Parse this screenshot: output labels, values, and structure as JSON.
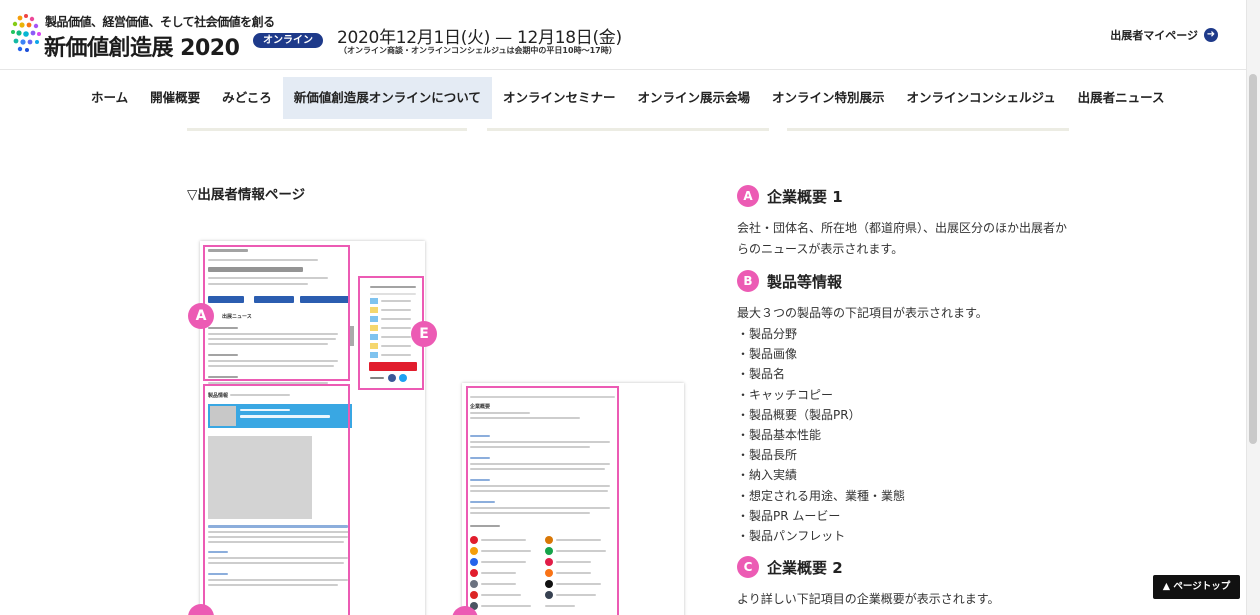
{
  "header": {
    "tagline": "製品価値、経営価値、そして社会価値を創る",
    "expo_name": "新価値創造展 2020",
    "online_badge": "オンライン",
    "date_range": "2020年12月1日(火) — 12月18日(金)",
    "date_note": "（オンライン商談・オンラインコンシェルジュは会期中の平日10時～17時）",
    "mypage_label": "出展者マイページ",
    "mypage_icon": "arrow-right-circle-icon"
  },
  "nav": {
    "items": [
      "ホーム",
      "開催概要",
      "みどころ",
      "新価値創造展オンラインについて",
      "オンラインセミナー",
      "オンライン展示会場",
      "オンライン特別展示",
      "オンラインコンシェルジュ",
      "出展者ニュース"
    ],
    "active_index": 3
  },
  "preview": {
    "heading": "▽出展者情報ページ",
    "markers": [
      "A",
      "E"
    ],
    "mock_text": {
      "news_label": "出展ニュース",
      "product_label": "製品情報",
      "company_label": "企業概要"
    }
  },
  "description": {
    "sections": [
      {
        "badge": "A",
        "title": "企業概要 1",
        "text": "会社・団体名、所在地（都道府県）、出展区分のほか出展者からのニュースが表示されます。"
      },
      {
        "badge": "B",
        "title": "製品等情報",
        "text": "最大３つの製品等の下記項目が表示されます。"
      },
      {
        "badge": "C",
        "title": "企業概要 2",
        "text": "より詳しい下記項目の企業概要が表示されます。"
      }
    ],
    "product_items": [
      "・製品分野",
      "・製品画像",
      "・製品名",
      "・キャッチコピー",
      "・製品概要（製品PR）",
      "・製品基本性能",
      "・製品長所",
      "・納入実績",
      "・想定される用途、業種・業態",
      "・製品PR ムービー",
      "・製品パンフレット"
    ]
  },
  "page_top_label": "▲ ページトップ",
  "colors": {
    "accent_pink": "#ec5bb4",
    "navy": "#1e3a8a",
    "nav_active_bg": "#e4ebf4"
  }
}
